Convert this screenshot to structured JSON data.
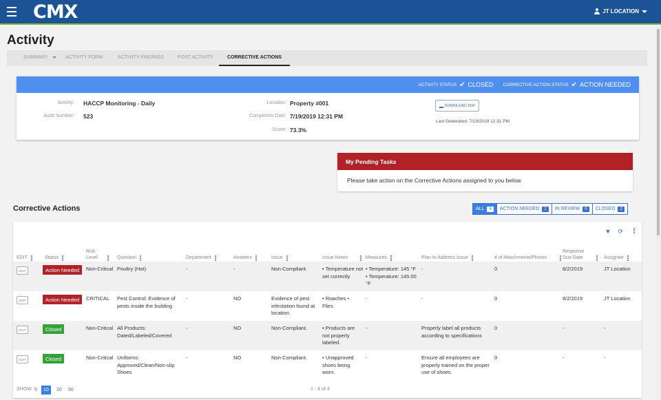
{
  "header": {
    "logo": "CMX",
    "user": "JT LOCATION"
  },
  "page": {
    "title": "Activity"
  },
  "tabs": {
    "summary": "SUMMARY",
    "activity_form": "ACTIVITY FORM",
    "activity_findings": "ACTIVITY FINDINGS",
    "post_activity": "POST ACTIVITY",
    "corrective_actions": "CORRECTIVE ACTIONS"
  },
  "card": {
    "activity_status_label": "ACTIVITY STATUS",
    "activity_status": "CLOSED",
    "ca_status_label": "CORRECTIVE ACTION STATUS",
    "ca_status": "ACTION NEEDED",
    "activity_label": "Activity:",
    "activity_value": "HACCP Monitoring - Daily",
    "audit_label": "Audit Number:",
    "audit_value": "523",
    "location_label": "Location:",
    "location_value": "Property #001",
    "completion_label": "Completion Date:",
    "completion_value": "7/19/2019 12:31 PM",
    "score_label": "Score:",
    "score_value": "73.3%",
    "download_label": "DOWNLOAD PDF",
    "last_generated": "Last Generated: 7/19/2019 12:31 PM"
  },
  "pending": {
    "title": "My Pending Tasks",
    "body": "Please take action on the Corrective Actions assigned to you below"
  },
  "ca": {
    "title": "Corrective Actions",
    "filters": {
      "all": {
        "label": "ALL",
        "count": "4"
      },
      "action_needed": {
        "label": "ACTION NEEDED",
        "count": "2"
      },
      "in_review": {
        "label": "IN REVIEW",
        "count": "0"
      },
      "closed": {
        "label": "CLOSED",
        "count": "2"
      }
    },
    "columns": {
      "edit": "EDIT",
      "status": "Status",
      "risk": "Risk Level",
      "question": "Question",
      "department": "Department",
      "answers": "Answers",
      "issue": "Issue",
      "notes": "Issue Notes",
      "measures": "Measures",
      "plan": "Plan to Address Issue",
      "attachments": "# of Attachments/Photos",
      "due": "Response Due Date",
      "assignee": "Assignee"
    },
    "rows": [
      {
        "edit": "EDIT",
        "status": "Action Needed",
        "risk": "Non-Critical",
        "question": "Poultry (Hot)",
        "department": "-",
        "answers": "-",
        "issue": "Non-Compliant.",
        "notes": "• Temperature not set correctly",
        "measures": "• Temperature: 145 °F • Temperature: 145.00 °F",
        "plan": "-",
        "attachments": "0",
        "due": "8/2/2019",
        "assignee": "JT Location"
      },
      {
        "edit": "EDIT",
        "status": "Action Needed",
        "risk": "CRITICAL",
        "question": "Pest Control: Evidence of pests inside the building",
        "department": "-",
        "answers": "NO",
        "issue": "Evidence of pest infestation found at location.",
        "notes": "• Roaches • Flies",
        "measures": "-",
        "plan": "-",
        "attachments": "0",
        "due": "8/2/2019",
        "assignee": "JT Location"
      },
      {
        "edit": "EDIT",
        "status": "Closed",
        "risk": "Non-Critical",
        "question": "All Products: Dated/Labeled/Covered",
        "department": "-",
        "answers": "NO",
        "issue": "Non-Compliant.",
        "notes": "• Products are not properly labeled.",
        "measures": "-",
        "plan": "Properly label all products according to specifications",
        "attachments": "0",
        "due": "-",
        "assignee": "-"
      },
      {
        "edit": "EDIT",
        "status": "Closed",
        "risk": "Non-Critical",
        "question": "Uniforms: Approved/Clean/Non-slip Shoes",
        "department": "-",
        "answers": "NO",
        "issue": "Non-Compliant.",
        "notes": "• Unapproved shoes being worn.",
        "measures": "-",
        "plan": "Ensure all employees are properly trained on the proper use of shoes.",
        "attachments": "0",
        "due": "-",
        "assignee": "-"
      }
    ],
    "footer": {
      "show_label": "SHOW",
      "sizes": [
        "5",
        "10",
        "20",
        "50"
      ],
      "selected": "10",
      "range": "1 - 4 of 4"
    }
  }
}
